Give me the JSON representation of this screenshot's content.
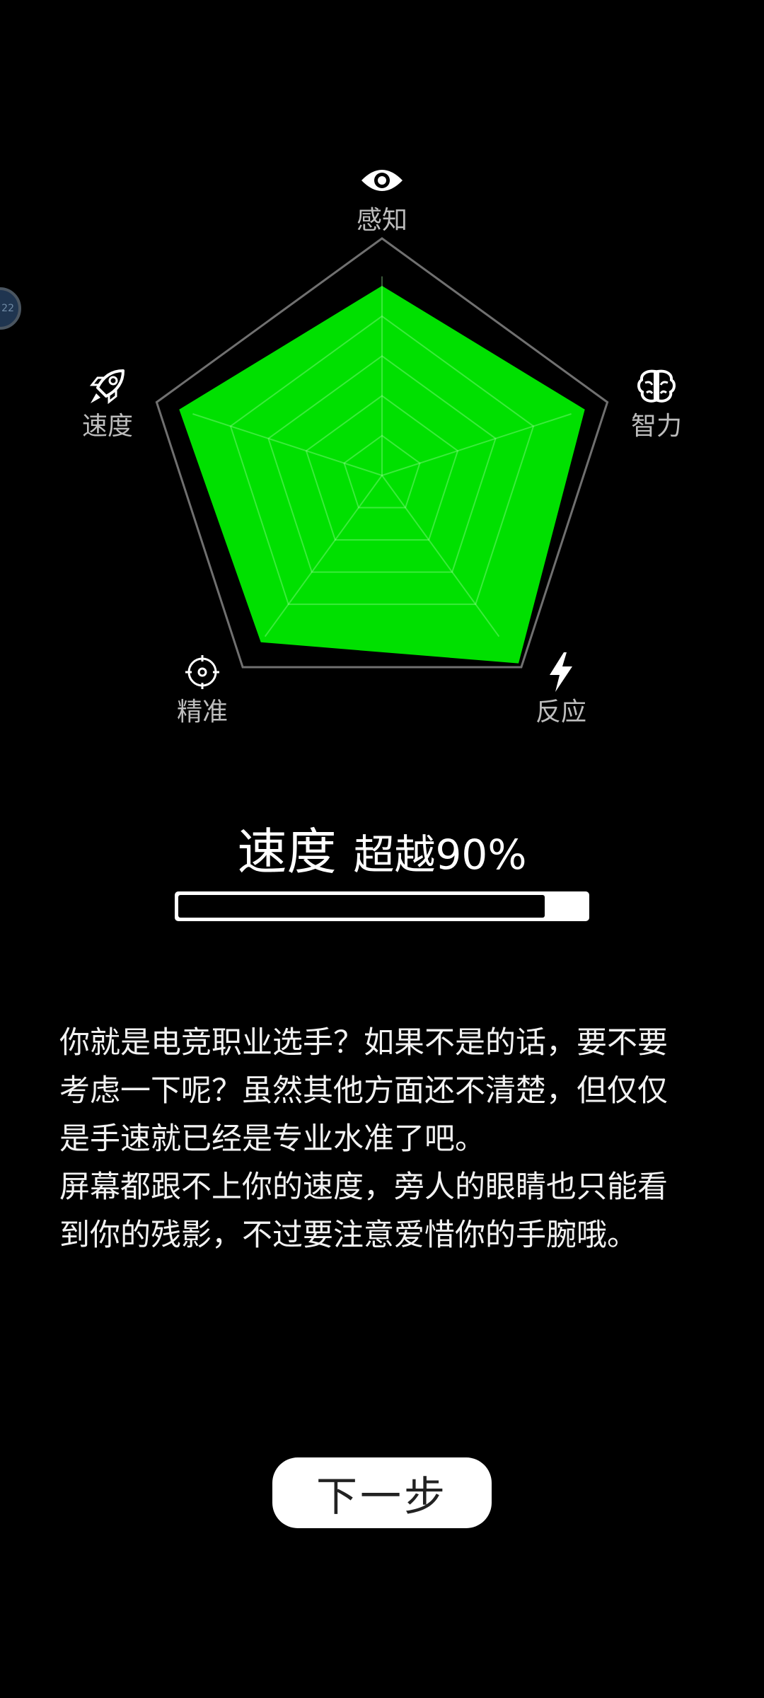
{
  "radar": {
    "axes": [
      {
        "label": "感知",
        "icon": "eye-icon",
        "value": 0.8
      },
      {
        "label": "智力",
        "icon": "brain-icon",
        "value": 0.9
      },
      {
        "label": "反应",
        "icon": "lightning-icon",
        "value": 0.98
      },
      {
        "label": "精准",
        "icon": "crosshair-icon",
        "value": 0.87
      },
      {
        "label": "速度",
        "icon": "rocket-icon",
        "value": 0.9
      }
    ],
    "levels": 5,
    "fill_color": "#00e000",
    "outline_color": "#707070"
  },
  "bubble": {
    "text": "22"
  },
  "headline": {
    "stat_name": "速度",
    "rank_text": "超越90%"
  },
  "progress": {
    "value": 0.9
  },
  "description": {
    "paragraphs": [
      "你就是电竞职业选手？如果不是的话，要不要考虑一下呢？虽然其他方面还不清楚，但仅仅是手速就已经是专业水准了吧。",
      "屏幕都跟不上你的速度，旁人的眼睛也只能看到你的残影，不过要注意爱惜你的手腕哦。"
    ]
  },
  "button": {
    "label": "下一步"
  }
}
